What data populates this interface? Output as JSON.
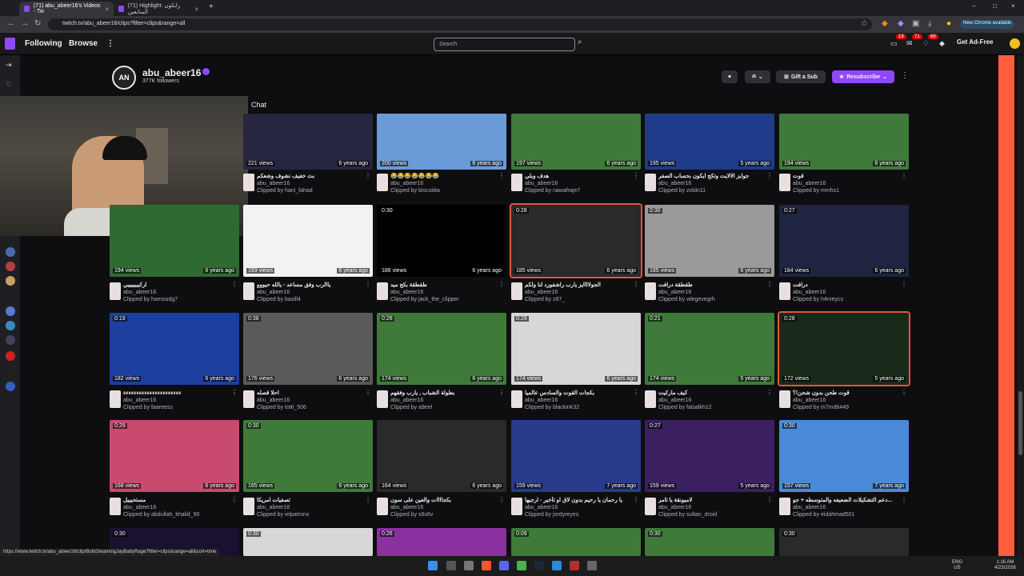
{
  "browser": {
    "tabs": [
      {
        "label": "(71) abu_abeer16's Videos - Tw"
      },
      {
        "label": "(71) Highlight: رابكون المتابعين"
      }
    ],
    "url": "twitch.tv/abu_abeer16/clips?filter=clips&range=all",
    "new_chrome_label": "New Chrome available"
  },
  "twitch_nav": {
    "following": "Following",
    "browse": "Browse",
    "search_placeholder": "Search",
    "badges": [
      "19",
      "71",
      "68"
    ],
    "get_ad_free": "Get Ad-Free"
  },
  "channel": {
    "logo_text": "AN",
    "name": "abu_abeer16",
    "followers": "377K followers",
    "gift_label": "Gift a Sub",
    "resub_label": "Resubscribe",
    "chat_label": "Chat"
  },
  "clips": [
    {
      "duration": "",
      "views": "221 views",
      "ago": "6 years ago",
      "title": "بث خفيف نشوف وشعكم",
      "channel": "abu_abeer16",
      "clipped_by": "Clipped by hani_fahad",
      "thumb": "#262640"
    },
    {
      "duration": "",
      "views": "200 views",
      "ago": "6 years ago",
      "title": "😂😂😂😂😂😂😂",
      "channel": "abu_abeer16",
      "clipped_by": "Clipped by biscuiiita",
      "thumb": "#6a9bd8"
    },
    {
      "duration": "",
      "views": "197 views",
      "ago": "6 years ago",
      "title": "هدف وبلي",
      "channel": "abu_abeer16",
      "clipped_by": "Clipped by nawafraje7",
      "thumb": "#3f7a3a"
    },
    {
      "duration": "",
      "views": "195 views",
      "ago": "5 years ago",
      "title": "جوايز الالايت وتكج ايكون بحساب الصفر",
      "channel": "abu_abeer16",
      "clipped_by": "Clipped by zoldn11",
      "thumb": "#1e3c8a"
    },
    {
      "duration": "",
      "views": "194 views",
      "ago": "6 years ago",
      "title": "قوت",
      "channel": "abu_abeer16",
      "clipped_by": "Clipped by mmhs1",
      "thumb": "#3f7a3a"
    },
    {
      "duration": "",
      "views": "194 views",
      "ago": "6 years ago",
      "title": "اركيييييييي",
      "channel": "abu_abeer16",
      "clipped_by": "Clipped by hamoudg7",
      "thumb": "#2f6b30"
    },
    {
      "duration": "",
      "views": "193 views",
      "ago": "6 years ago",
      "title": "ياالرب وفق مساعد - يالله حيووو",
      "channel": "abu_abeer16",
      "clipped_by": "Clipped by basill4",
      "thumb": "#f2f2f2"
    },
    {
      "duration": "0:30",
      "views": "186 views",
      "ago": "6 years ago",
      "title": "طقطقة بكج ميد",
      "channel": "abu_abeer16",
      "clipped_by": "Clipped by jack_the_clipper",
      "thumb": "#000000"
    },
    {
      "duration": "0:28",
      "views": "185 views",
      "ago": "6 years ago",
      "title": "الجولاااايز يارب راشفورد لنا ولكم",
      "channel": "abu_abeer16",
      "clipped_by": "Clipped by z87_",
      "thumb": "#2a2a2a"
    },
    {
      "duration": "0:30",
      "views": "185 views",
      "ago": "6 years ago",
      "title": "طقطقة درافت",
      "channel": "abu_abeer16",
      "clipped_by": "Clipped by wlegevegrh",
      "thumb": "#9a9a9a"
    },
    {
      "duration": "0:27",
      "views": "184 views",
      "ago": "6 years ago",
      "title": "درافت",
      "channel": "abu_abeer16",
      "clipped_by": "Clipped by h4rveycs",
      "thumb": "#1f2440"
    },
    {
      "duration": "0:19",
      "views": "182 views",
      "ago": "6 years ago",
      "title": "ءءءءءءءءءءءءءءءءءءءءءء",
      "channel": "abu_abeer16",
      "clipped_by": "Clipped by faareess",
      "thumb": "#1d3fa0"
    },
    {
      "duration": "0:38",
      "views": "176 views",
      "ago": "6 years ago",
      "title": "احلا قصله",
      "channel": "abu_abeer16",
      "clipped_by": "Clipped by totti_506",
      "thumb": "#5a5a5a"
    },
    {
      "duration": "0:28",
      "views": "174 views",
      "ago": "6 years ago",
      "title": "بطولة الشباب , يارب وفقهم",
      "channel": "abu_abeer16",
      "clipped_by": "Clipped by a9eel",
      "thumb": "#3f7a3a"
    },
    {
      "duration": "0:29",
      "views": "174 views",
      "ago": "6 years ago",
      "title": "بكجات القوت والسادس عالميا",
      "channel": "abu_abeer16",
      "clipped_by": "Clipped by blackink32",
      "thumb": "#d7d7d7"
    },
    {
      "duration": "0:21",
      "views": "174 views",
      "ago": "5 years ago",
      "title": "كيف ماركيت",
      "channel": "abu_abeer16",
      "clipped_by": "Clipped by faisalkh12",
      "thumb": "#3f7a3a"
    },
    {
      "duration": "0:28",
      "views": "172 views",
      "ago": "5 years ago",
      "title": "قوت طحن بدون شحن!؟",
      "channel": "abu_abeer16",
      "clipped_by": "Clipped by m7md6449",
      "thumb": "#1a2a1a"
    },
    {
      "duration": "0:29",
      "views": "168 views",
      "ago": "6 years ago",
      "title": "مستحيييل",
      "channel": "abu_abeer16",
      "clipped_by": "Clipped by abdullah_khalid_90",
      "thumb": "#c84a6e"
    },
    {
      "duration": "0:30",
      "views": "165 views",
      "ago": "6 years ago",
      "title": "تصفيات امريكا",
      "channel": "abu_abeer16",
      "clipped_by": "Clipped by ielpatronx",
      "thumb": "#3f7a3a"
    },
    {
      "duration": "",
      "views": "164 views",
      "ago": "6 years ago",
      "title": "بكجاااات والعين على سون",
      "channel": "abu_abeer16",
      "clipped_by": "Clipped by s6s6v",
      "thumb": "#2a2a2a"
    },
    {
      "duration": "",
      "views": "159 views",
      "ago": "7 years ago",
      "title": "يا رحمان يا رحيم بدون لاق او تأخير - ارجيها",
      "channel": "abu_abeer16",
      "clipped_by": "Clipped by jordyreyes",
      "thumb": "#2a3a8a"
    },
    {
      "duration": "0:27",
      "views": "159 views",
      "ago": "5 years ago",
      "title": "لاميونقة يا ثامر",
      "channel": "abu_abeer16",
      "clipped_by": "Clipped by sultan_droid",
      "thumb": "#3a2060"
    },
    {
      "duration": "0:30",
      "views": "157 views",
      "ago": "7 years ago",
      "title": "دعم التشكيلات الضعيفه والمتوسطه + جو...",
      "channel": "abu_abeer16",
      "clipped_by": "Clipped by eidahmad501",
      "thumb": "#4a8ad8"
    },
    {
      "duration": "0:30",
      "views": "",
      "ago": "",
      "title": "",
      "channel": "",
      "clipped_by": "",
      "thumb": "#1a1030"
    },
    {
      "duration": "0:30",
      "views": "",
      "ago": "",
      "title": "",
      "channel": "",
      "clipped_by": "",
      "thumb": "#d7d7d7"
    },
    {
      "duration": "0:26",
      "views": "",
      "ago": "",
      "title": "",
      "channel": "",
      "clipped_by": "",
      "thumb": "#8a30a0"
    },
    {
      "duration": "0:09",
      "views": "",
      "ago": "",
      "title": "",
      "channel": "",
      "clipped_by": "",
      "thumb": "#3f7a3a"
    },
    {
      "duration": "0:30",
      "views": "",
      "ago": "",
      "title": "",
      "channel": "",
      "clipped_by": "",
      "thumb": "#3f7a3a"
    },
    {
      "duration": "0:30",
      "views": "",
      "ago": "",
      "title": "",
      "channel": "",
      "clipped_by": "",
      "thumb": "#2a2a2a"
    }
  ],
  "status_url": "https://www.twitch.tv/abu_abeer16/clip/BoldGleamingJayBabyRage?filter=clips&range=all&sort=time",
  "taskbar": {
    "lang_top": "ENG",
    "lang_bottom": "US",
    "time": "1:16 AM",
    "date": "4/23/2026"
  }
}
